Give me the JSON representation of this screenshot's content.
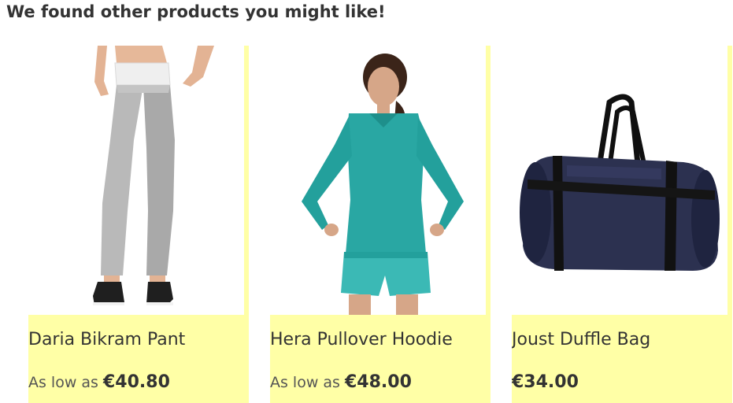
{
  "heading": "We found other products you might like!",
  "products": [
    {
      "name": "Daria Bikram Pant",
      "price_label": "As low as",
      "price": "€40.80",
      "image_icon": "daria-bikram-pant-image"
    },
    {
      "name": "Hera Pullover Hoodie",
      "price_label": "As low as",
      "price": "€48.00",
      "image_icon": "hera-pullover-hoodie-image"
    },
    {
      "name": "Joust Duffle Bag",
      "price_label": "",
      "price": "€34.00",
      "image_icon": "joust-duffle-bag-image"
    }
  ],
  "colors": {
    "card_background": "#ffffa6",
    "text": "#333333"
  }
}
